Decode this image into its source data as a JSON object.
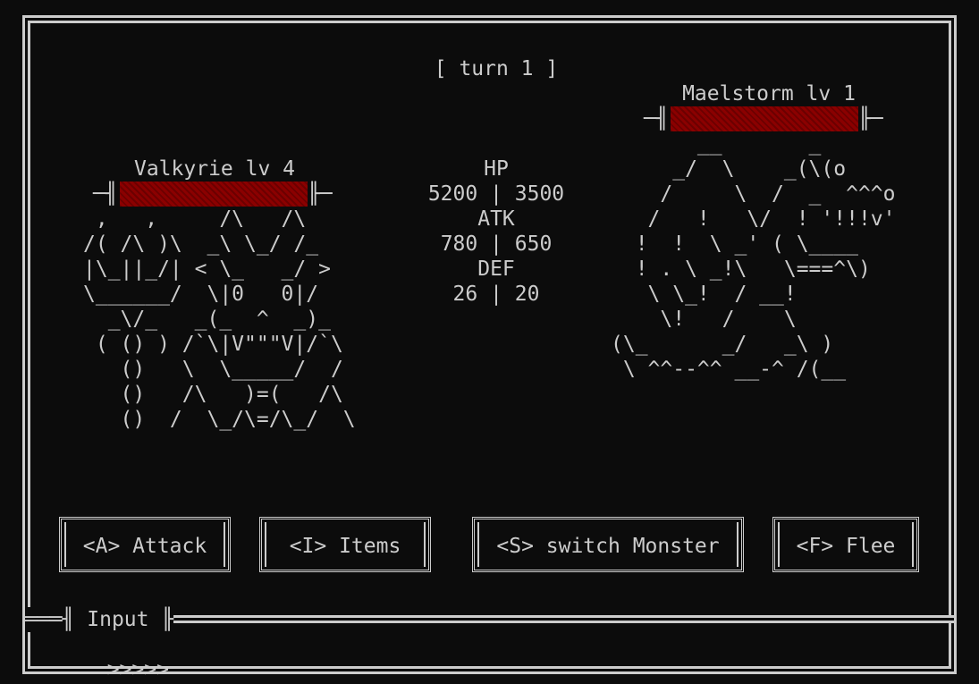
{
  "turn_label": "[ turn 1 ]",
  "player": {
    "name_label": "Valkyrie lv 4",
    "hp_fraction": 1.0,
    "art": [
      " ,   ,     /\\   /\\",
      "/( /\\ )\\  _\\ \\_/ /_",
      "|\\_||_/| < \\_   _/ >",
      "\\______/  \\|0   0|/",
      "  _\\/_   _(_  ^  _)_",
      " ( () ) /`\\|V\"\"\"V|/`\\",
      "   ()   \\  \\_____/  /",
      "   ()   /\\   )=(   /\\",
      "   ()  /  \\_/\\=/\\_/  \\"
    ]
  },
  "enemy": {
    "name_label": "Maelstorm lv 1",
    "hp_fraction": 1.0,
    "art": [
      "       __       _",
      "     _/  \\    _(\\(o",
      "    /     \\  /  _  ^^^o",
      "   /   !   \\/  ! '!!!v'",
      "  !  !  \\ _' ( \\____",
      "  ! . \\ _!\\   \\===^\\)",
      "   \\ \\_!  / __!",
      "    \\!   /    \\",
      "(\\_      _/   _\\ )",
      " \\ ^^--^^ __-^ /(__"
    ]
  },
  "stats": {
    "hp_label": "HP",
    "hp_values": "5200 | 3500",
    "atk_label": "ATK",
    "atk_values": "780 | 650",
    "def_label": "DEF",
    "def_values": "26 | 20"
  },
  "actions": {
    "attack": "<A> Attack",
    "items": "<I> Items",
    "switch": "<S> switch Monster",
    "flee": "<F> Flee"
  },
  "input": {
    "title": "Input",
    "prompt": ">>>>>"
  },
  "colors": {
    "background": "#0c0c0c",
    "text": "#cccccc",
    "hp_bar": "#8b0000"
  }
}
